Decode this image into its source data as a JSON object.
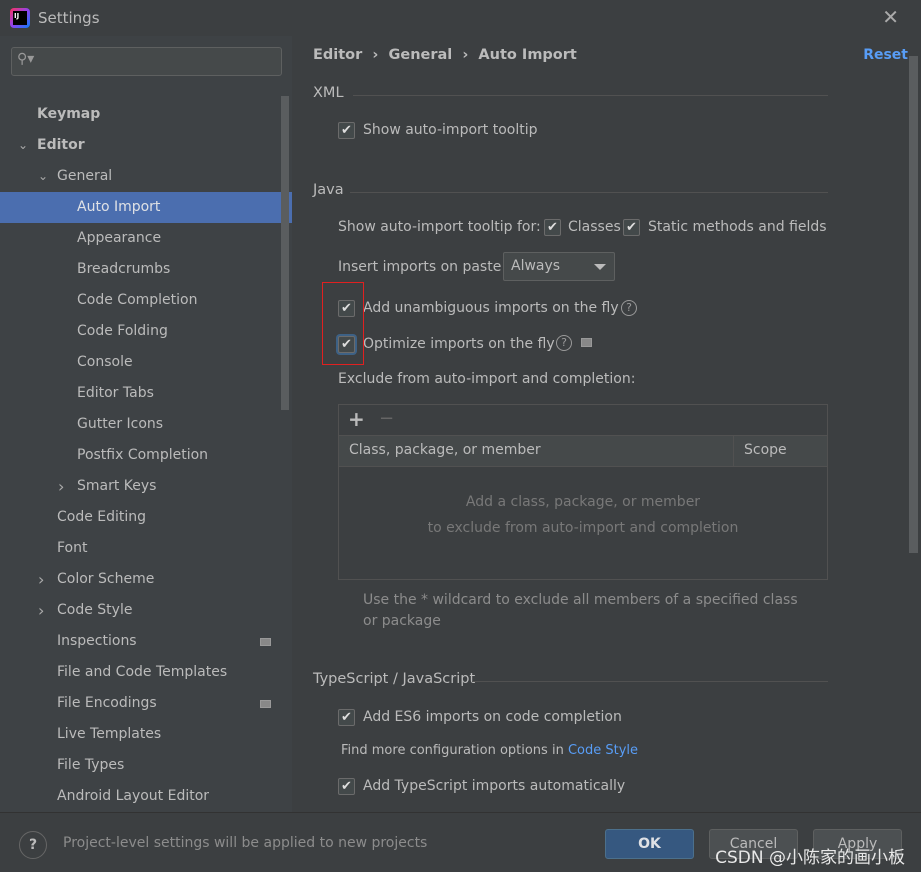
{
  "window": {
    "title": "Settings",
    "close_icon": "close-icon"
  },
  "search": {
    "placeholder": ""
  },
  "sidebar": {
    "items": [
      {
        "label": "Keymap",
        "level": 0,
        "bold": true
      },
      {
        "label": "Editor",
        "level": 0,
        "bold": true,
        "expanded": true
      },
      {
        "label": "General",
        "level": 1,
        "expanded": true
      },
      {
        "label": "Auto Import",
        "level": 2,
        "selected": true
      },
      {
        "label": "Appearance",
        "level": 2
      },
      {
        "label": "Breadcrumbs",
        "level": 2
      },
      {
        "label": "Code Completion",
        "level": 2
      },
      {
        "label": "Code Folding",
        "level": 2
      },
      {
        "label": "Console",
        "level": 2
      },
      {
        "label": "Editor Tabs",
        "level": 2
      },
      {
        "label": "Gutter Icons",
        "level": 2
      },
      {
        "label": "Postfix Completion",
        "level": 2
      },
      {
        "label": "Smart Keys",
        "level": 2,
        "collapsed": true
      },
      {
        "label": "Code Editing",
        "level": 1
      },
      {
        "label": "Font",
        "level": 1
      },
      {
        "label": "Color Scheme",
        "level": 1,
        "collapsed": true
      },
      {
        "label": "Code Style",
        "level": 1,
        "collapsed": true
      },
      {
        "label": "Inspections",
        "level": 1,
        "badge": true
      },
      {
        "label": "File and Code Templates",
        "level": 1
      },
      {
        "label": "File Encodings",
        "level": 1,
        "badge": true
      },
      {
        "label": "Live Templates",
        "level": 1
      },
      {
        "label": "File Types",
        "level": 1
      },
      {
        "label": "Android Layout Editor",
        "level": 1
      }
    ]
  },
  "main": {
    "breadcrumb": "Editor  ›  General  ›  Auto Import",
    "reset": "Reset",
    "xml": {
      "title": "XML",
      "show_tooltip": "Show auto-import tooltip"
    },
    "java": {
      "title": "Java",
      "tooltip_for": "Show auto-import tooltip for:",
      "classes": "Classes",
      "static": "Static methods and fields",
      "insert_label": "Insert imports on paste:",
      "insert_value": "Always",
      "add_unambiguous": "Add unambiguous imports on the fly",
      "optimize": "Optimize imports on the fly",
      "exclude_label": "Exclude from auto-import and completion:",
      "add": "+",
      "remove": "−",
      "col1": "Class, package, or member",
      "col2": "Scope",
      "empty1": "Add a class, package, or member",
      "empty2": "to exclude from auto-import and completion",
      "hint": "Use the * wildcard to exclude all members of a specified class or package"
    },
    "ts": {
      "title": "TypeScript / JavaScript",
      "es6": "Add ES6 imports on code completion",
      "more": "Find more configuration options in",
      "link": "Code Style",
      "auto": "Add TypeScript imports automatically"
    }
  },
  "footer": {
    "help": "?",
    "note": "Project-level settings will be applied to new projects",
    "ok": "OK",
    "cancel": "Cancel",
    "apply": "Apply",
    "watermark": "CSDN @小陈家的画小板"
  }
}
